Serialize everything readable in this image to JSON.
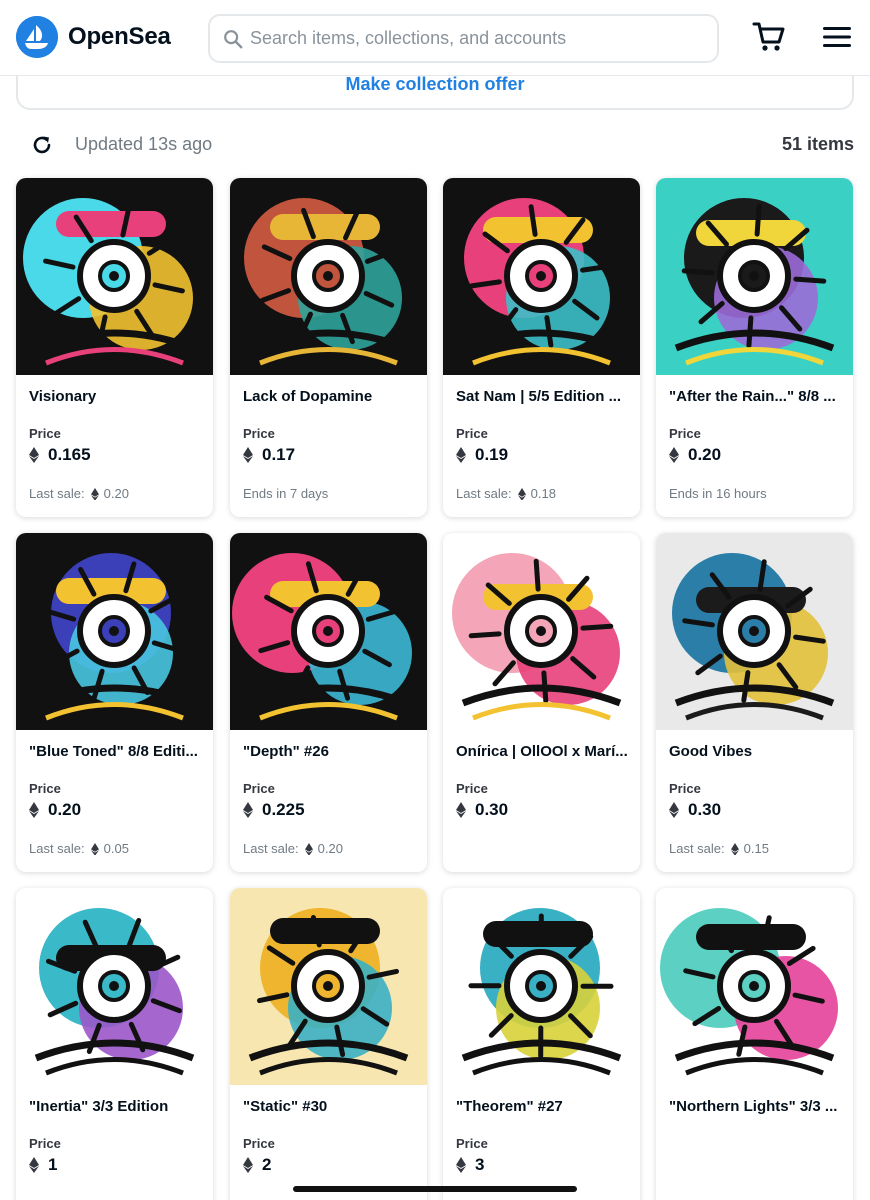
{
  "brand": {
    "name": "OpenSea",
    "accent": "#2081e2"
  },
  "search": {
    "placeholder": "Search items, collections, and accounts"
  },
  "offer_button": {
    "label": "Make collection offer"
  },
  "toolbar": {
    "updated": "Updated 13s ago",
    "count": "51 items"
  },
  "price_label": "Price",
  "items": [
    {
      "name": "Visionary",
      "price": "0.165",
      "meta_prefix": "Last sale:",
      "meta_value": "0.20",
      "palette": [
        "#4ad9e8",
        "#f2c230",
        "#e8407a",
        "#111111"
      ]
    },
    {
      "name": "Lack of Dopamine",
      "price": "0.17",
      "meta_prefix": "Ends in 7 days",
      "meta_value": "",
      "palette": [
        "#c1543c",
        "#2fa39a",
        "#e8b637",
        "#111111"
      ]
    },
    {
      "name": "Sat Nam | 5/5 Edition ...",
      "price": "0.19",
      "meta_prefix": "Last sale:",
      "meta_value": "0.18",
      "palette": [
        "#e8407a",
        "#3cc0c9",
        "#f2c230",
        "#111111"
      ]
    },
    {
      "name": "\"After the Rain...\" 8/8 ...",
      "price": "0.20",
      "meta_prefix": "Ends in 16 hours",
      "meta_value": "",
      "palette": [
        "#1a1a1a",
        "#9b6bd8",
        "#f0d63a",
        "#3ad1c4"
      ]
    },
    {
      "name": "\"Blue Toned\" 8/8 Editi...",
      "price": "0.20",
      "meta_prefix": "Last sale:",
      "meta_value": "0.05",
      "palette": [
        "#3b3fb8",
        "#48c7e0",
        "#f2c230",
        "#111111"
      ]
    },
    {
      "name": "\"Depth\" #26",
      "price": "0.225",
      "meta_prefix": "Last sale:",
      "meta_value": "0.20",
      "palette": [
        "#e8407a",
        "#3cb8d6",
        "#f2c230",
        "#111111"
      ]
    },
    {
      "name": "Onírica | OllOOl x Marí...",
      "price": "0.30",
      "meta_prefix": "",
      "meta_value": "",
      "palette": [
        "#f4a6b8",
        "#e8407a",
        "#f2c230",
        "#ffffff"
      ]
    },
    {
      "name": "Good Vibes",
      "price": "0.30",
      "meta_prefix": "Last sale:",
      "meta_value": "0.15",
      "palette": [
        "#2a7ea8",
        "#e2c13a",
        "#1b1b1b",
        "#e9e9e9"
      ]
    },
    {
      "name": "\"Inertia\" 3/3 Edition",
      "price": "1",
      "meta_prefix": "",
      "meta_value": "",
      "palette": [
        "#3ab9c9",
        "#9b57c9",
        "#111111",
        "#ffffff"
      ]
    },
    {
      "name": "\"Static\" #30",
      "price": "2",
      "meta_prefix": "",
      "meta_value": "",
      "palette": [
        "#efb52f",
        "#3ab0c4",
        "#111111",
        "#f7e6b0"
      ]
    },
    {
      "name": "\"Theorem\" #27",
      "price": "3",
      "meta_prefix": "",
      "meta_value": "",
      "palette": [
        "#3ab0c4",
        "#d8d13a",
        "#111111",
        "#ffffff"
      ]
    },
    {
      "name": "\"Northern Lights\" 3/3 ...",
      "price": "",
      "meta_prefix": "",
      "meta_value": "",
      "palette": [
        "#5cd1c3",
        "#e6419a",
        "#111111",
        "#ffffff"
      ]
    }
  ]
}
